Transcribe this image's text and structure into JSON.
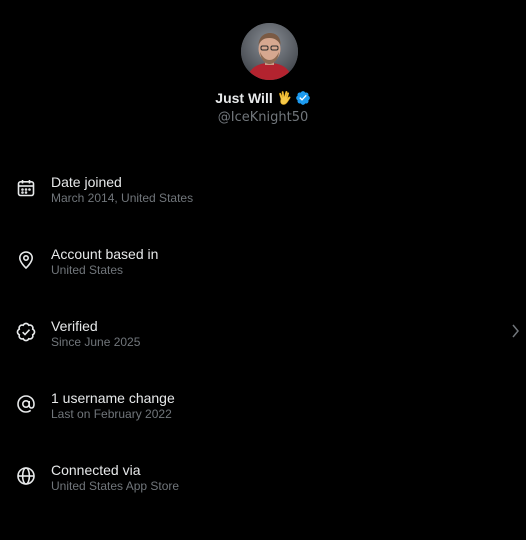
{
  "profile": {
    "name": "Just Will",
    "emoji": "🖖",
    "verified": true,
    "handle": "@IceKnight50"
  },
  "about": {
    "items": [
      {
        "title": "Date joined",
        "subtitle": "March 2014, United States",
        "icon": "calendar-icon",
        "chevron": false
      },
      {
        "title": "Account based in",
        "subtitle": "United States",
        "icon": "location-pin-icon",
        "chevron": false
      },
      {
        "title": "Verified",
        "subtitle": "Since June 2025",
        "icon": "verified-check-icon",
        "chevron": true
      },
      {
        "title": "1 username change",
        "subtitle": "Last on February 2022",
        "icon": "at-sign-icon",
        "chevron": false
      },
      {
        "title": "Connected via",
        "subtitle": "United States App Store",
        "icon": "globe-icon",
        "chevron": false
      }
    ]
  },
  "colors": {
    "background": "#000000",
    "primary_text": "#e7e9ea",
    "secondary_text": "#71767b",
    "verified_blue": "#1d9bf0"
  }
}
